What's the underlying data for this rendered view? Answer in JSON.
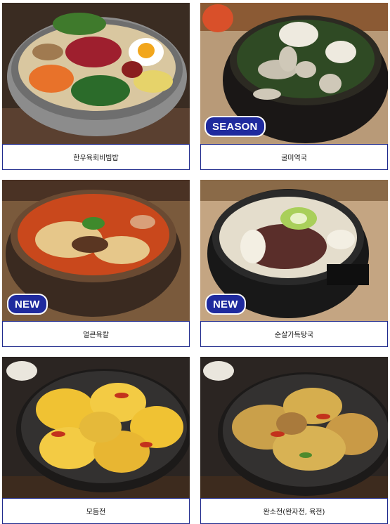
{
  "menu_items": [
    {
      "name": "한우육회비빔밥",
      "badge": ""
    },
    {
      "name": "굴미역국",
      "badge": "SEASON"
    },
    {
      "name": "얼큰육칼",
      "badge": "NEW"
    },
    {
      "name": "순살가득탕국",
      "badge": "NEW"
    },
    {
      "name": "모듬전",
      "badge": ""
    },
    {
      "name": "완소전(완자전, 육전)",
      "badge": ""
    }
  ],
  "colors": {
    "caption_border": "#1f2a8c",
    "badge_bg": "#1f2a9e"
  }
}
